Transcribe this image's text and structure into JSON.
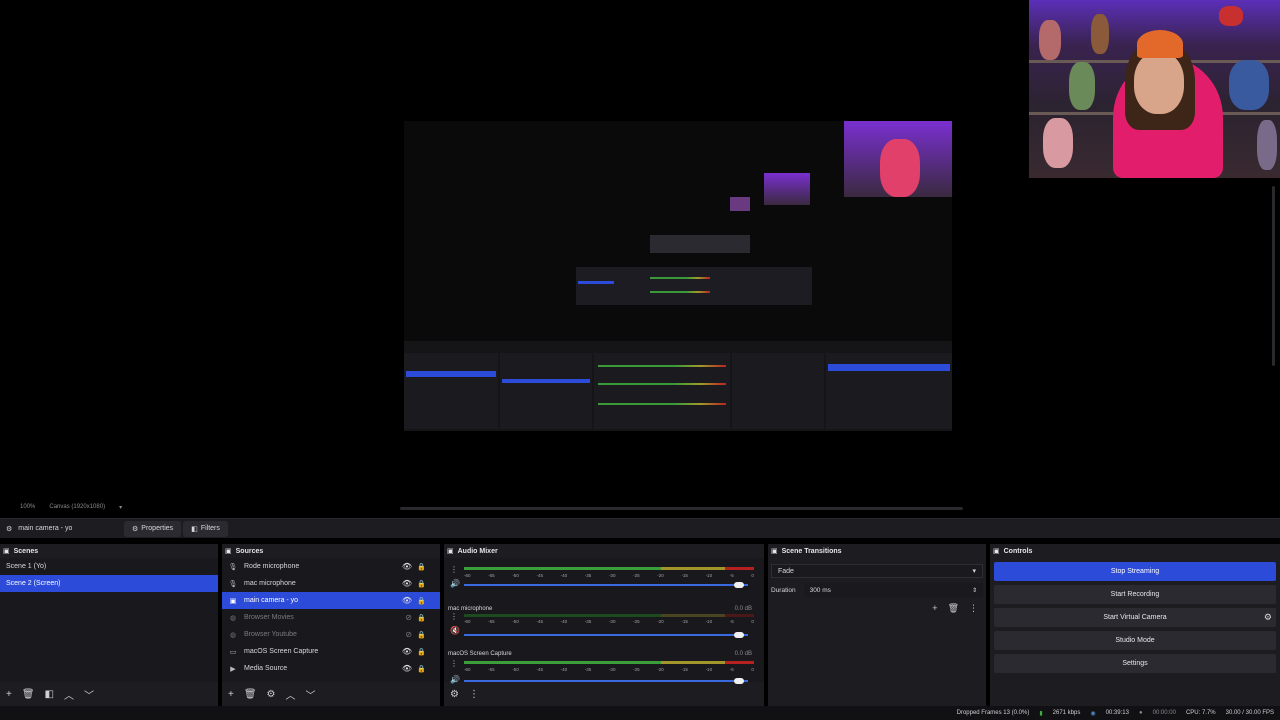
{
  "zoombar": {
    "zoom": "100%",
    "canvas": "Canvas (1920x1080)"
  },
  "context": {
    "source_name": "main camera - yo",
    "properties": "Properties",
    "filters": "Filters"
  },
  "scenes": {
    "title": "Scenes",
    "items": [
      {
        "label": "Scene 1 (Yo)",
        "selected": false
      },
      {
        "label": "Scene 2 (Screen)",
        "selected": true
      }
    ]
  },
  "sources": {
    "title": "Sources",
    "items": [
      {
        "label": "Rode microphone",
        "icon": "microphone-icon",
        "visible": true
      },
      {
        "label": "mac microphone",
        "icon": "microphone-icon",
        "visible": true
      },
      {
        "label": "main camera - yo",
        "icon": "camera-icon",
        "visible": true,
        "selected": true
      },
      {
        "label": "Browser Movies",
        "icon": "browser-icon",
        "visible": false
      },
      {
        "label": "Browser Youtube",
        "icon": "browser-icon",
        "visible": false
      },
      {
        "label": "macOS Screen Capture",
        "icon": "display-icon",
        "visible": true
      },
      {
        "label": "Media Source",
        "icon": "play-icon",
        "visible": true
      }
    ]
  },
  "mixer": {
    "title": "Audio Mixer",
    "ticks": [
      "-60",
      "-55",
      "-50",
      "-45",
      "-40",
      "-35",
      "-30",
      "-25",
      "-20",
      "-15",
      "-10",
      "-5",
      "0"
    ],
    "channels": [
      {
        "name": "",
        "db": "",
        "active": true,
        "volume": 0.97
      },
      {
        "name": "mac microphone",
        "db": "0.0 dB",
        "active": false,
        "volume": 0.97
      },
      {
        "name": "macOS Screen Capture",
        "db": "0.0 dB",
        "active": true,
        "volume": 0.97
      }
    ]
  },
  "transitions": {
    "title": "Scene Transitions",
    "type": "Fade",
    "duration_label": "Duration",
    "duration_value": "300 ms"
  },
  "controls": {
    "title": "Controls",
    "stop_streaming": "Stop Streaming",
    "start_recording": "Start Recording",
    "start_virtual_camera": "Start Virtual Camera",
    "studio_mode": "Studio Mode",
    "settings": "Settings"
  },
  "status": {
    "dropped_frames": "Dropped Frames 13 (0.0%)",
    "bitrate": "2671 kbps",
    "stream_time": "00:39:13",
    "rec_time": "00:00:00",
    "cpu": "CPU: 7.7%",
    "fps": "30.00 / 30.00 FPS"
  },
  "colors": {
    "accent": "#2d4bd9",
    "panel": "#1d1d21",
    "background": "#000000"
  }
}
